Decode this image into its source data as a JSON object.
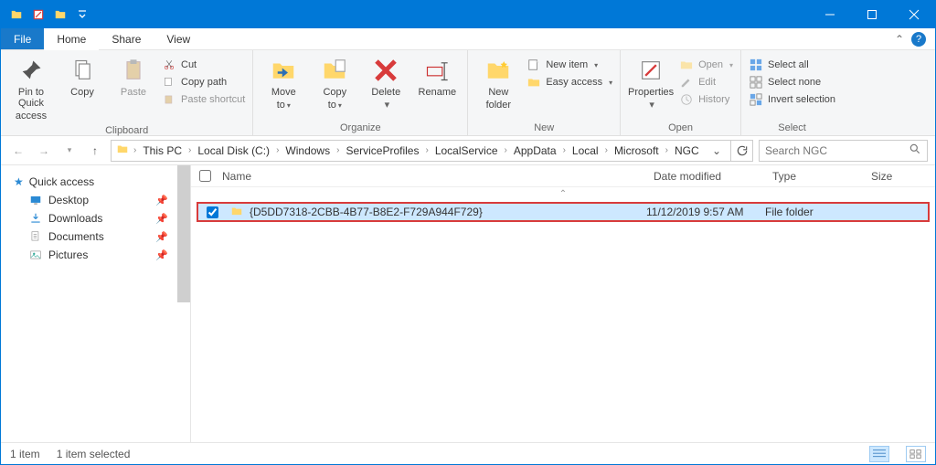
{
  "tabs": {
    "file": "File",
    "home": "Home",
    "share": "Share",
    "view": "View"
  },
  "ribbon": {
    "pin1": "Pin to Quick",
    "pin2": "access",
    "copy": "Copy",
    "paste": "Paste",
    "cut": "Cut",
    "copypath": "Copy path",
    "pasteshortcut": "Paste shortcut",
    "clipboard_label": "Clipboard",
    "move1": "Move",
    "move2": "to",
    "copyto1": "Copy",
    "copyto2": "to",
    "delete": "Delete",
    "rename": "Rename",
    "organize_label": "Organize",
    "newfolder1": "New",
    "newfolder2": "folder",
    "newitem": "New item",
    "easyaccess": "Easy access",
    "new_label": "New",
    "properties": "Properties",
    "open": "Open",
    "edit": "Edit",
    "history": "History",
    "open_label": "Open",
    "selectall": "Select all",
    "selectnone": "Select none",
    "invert": "Invert selection",
    "select_label": "Select"
  },
  "breadcrumb": [
    "This PC",
    "Local Disk (C:)",
    "Windows",
    "ServiceProfiles",
    "LocalService",
    "AppData",
    "Local",
    "Microsoft",
    "NGC"
  ],
  "search_placeholder": "Search NGC",
  "nav": {
    "quick": "Quick access",
    "desktop": "Desktop",
    "downloads": "Downloads",
    "documents": "Documents",
    "pictures": "Pictures"
  },
  "columns": {
    "name": "Name",
    "date": "Date modified",
    "type": "Type",
    "size": "Size"
  },
  "row": {
    "name": "{D5DD7318-2CBB-4B77-B8E2-F729A944F729}",
    "date": "11/12/2019 9:57 AM",
    "type": "File folder",
    "size": ""
  },
  "status": {
    "count": "1 item",
    "selected": "1 item selected"
  }
}
